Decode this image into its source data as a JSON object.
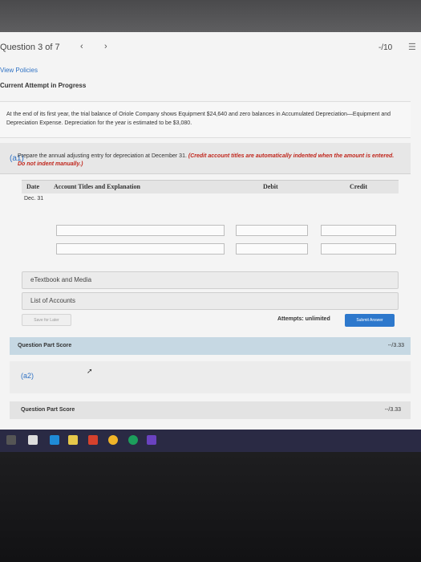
{
  "header": {
    "question": "Question 3 of 7",
    "prev_icon": "‹",
    "next_icon": "›",
    "score": "-/10",
    "list_icon": "list-icon"
  },
  "links": {
    "view_policies": "View Policies"
  },
  "attempt_status": "Current Attempt in Progress",
  "problem": "At the end of its first year, the trial balance of Oriole Company shows Equipment $24,640 and zero balances in Accumulated Depreciation—Equipment and Depreciation Expense. Depreciation for the year is estimated to be $3,080.",
  "part_a1": {
    "label": "(a1)",
    "instruction": "Prepare the annual adjusting entry for depreciation at December 31.",
    "instruction_note": "(Credit account titles are automatically indented when the amount is entered. Do not indent manually.)",
    "table": {
      "col_date": "Date",
      "col_account": "Account Titles and Explanation",
      "col_debit": "Debit",
      "col_credit": "Credit",
      "date": "Dec. 31"
    },
    "etextbook": "eTextbook and Media",
    "list_accounts": "List of Accounts",
    "save_later": "Save for Later",
    "attempts": "Attempts: unlimited",
    "submit": "Submit Answer",
    "part_score_label": "Question Part Score",
    "part_score": "--/3.33"
  },
  "part_a2": {
    "label": "(a2)",
    "part_score_label": "Question Part Score",
    "part_score": "--/3.33"
  },
  "colors": {
    "accent": "#2d78cc",
    "note_red": "#c0261c",
    "score_bar": "#c6d8e3"
  }
}
